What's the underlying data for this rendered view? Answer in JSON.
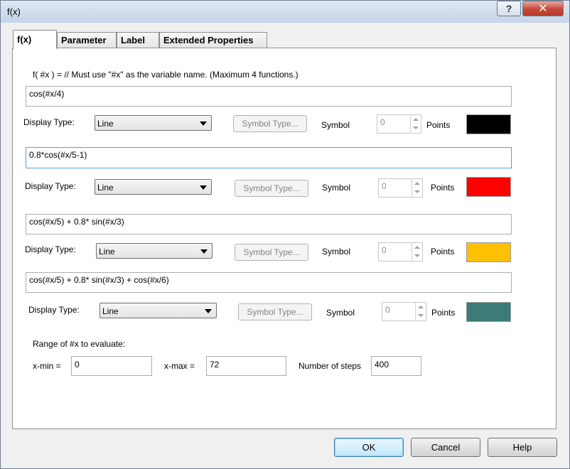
{
  "window": {
    "title": "f(x)",
    "help_glyph": "?",
    "close_glyph": "✕"
  },
  "tabs": [
    {
      "label": "f(x)"
    },
    {
      "label": "Parameter"
    },
    {
      "label": "Label"
    },
    {
      "label": "Extended Properties"
    }
  ],
  "instructions": "f( #x ) =  // Must use \"#x\" as the variable name. (Maximum 4 functions.)",
  "functions": [
    {
      "expression": "cos(#x/4)",
      "display_type_label": "Display Type:",
      "display_type": "Line",
      "symbol_type_button": "Symbol Type...",
      "symbol_label": "Symbol",
      "points_value": "0",
      "points_label": "Points",
      "color": "#000000"
    },
    {
      "expression": "0.8*cos(#x/5-1)",
      "display_type_label": "Display Type:",
      "display_type": "Line",
      "symbol_type_button": "Symbol Type...",
      "symbol_label": "Symbol",
      "points_value": "0",
      "points_label": "Points",
      "color": "#ff0000"
    },
    {
      "expression": "cos(#x/5) + 0.8* sin(#x/3)",
      "display_type_label": "Display Type:",
      "display_type": "Line",
      "symbol_type_button": "Symbol Type...",
      "symbol_label": "Symbol",
      "points_value": "0",
      "points_label": "Points",
      "color": "#ffc000"
    },
    {
      "expression": "cos(#x/5) + 0.8* sin(#x/3) + cos(#x/6)",
      "display_type_label": "Display Type:",
      "display_type": "Line",
      "symbol_type_button": "Symbol Type...",
      "symbol_label": "Symbol",
      "points_value": "0",
      "points_label": "Points",
      "color": "#3d7b78"
    }
  ],
  "range": {
    "heading": "Range of #x to evaluate:",
    "xmin_label": "x-min =",
    "xmin_value": "0",
    "xmax_label": "x-max =",
    "xmax_value": "72",
    "steps_label": "Number of steps",
    "steps_value": "400"
  },
  "buttons": {
    "ok": "OK",
    "cancel": "Cancel",
    "help": "Help"
  }
}
